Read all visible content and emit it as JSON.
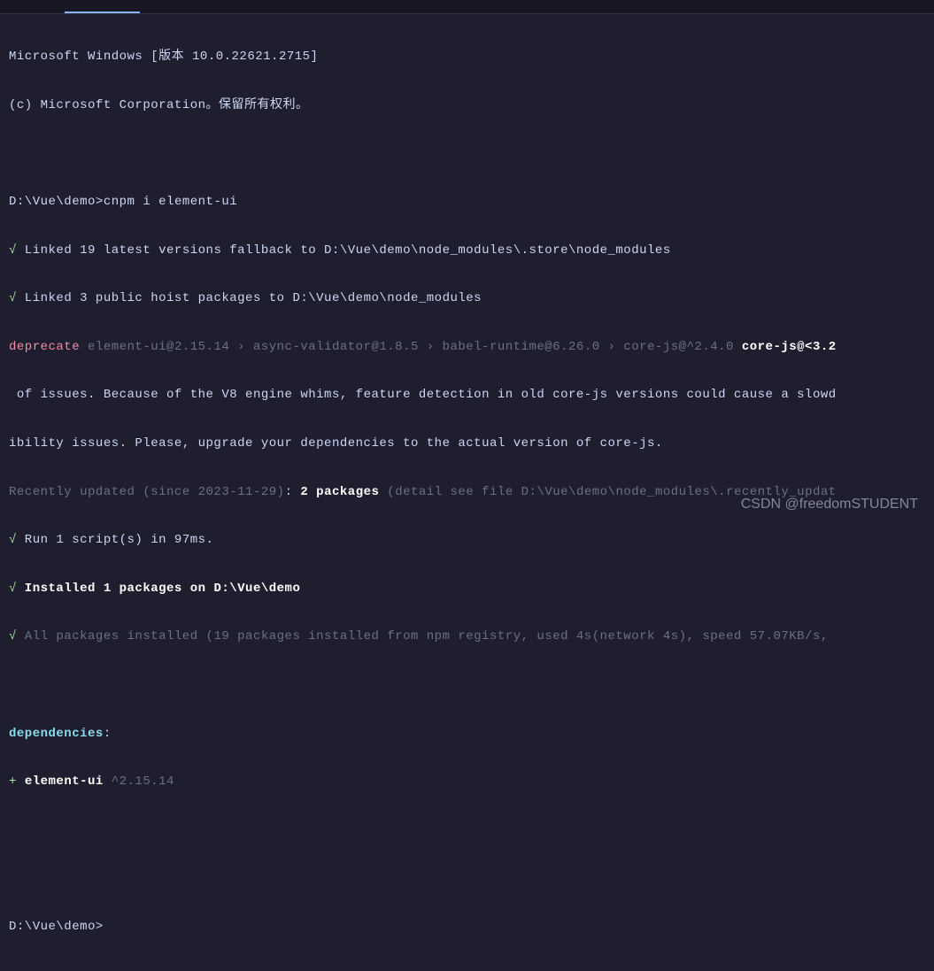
{
  "header": {
    "os_line": "Microsoft Windows [版本 10.0.22621.2715]",
    "copyright": "(c) Microsoft Corporation。保留所有权利。"
  },
  "prompt1": {
    "path": "D:\\Vue\\demo>",
    "command": "cnpm i element-ui"
  },
  "output": {
    "check1_mark": "√",
    "check1_text": " Linked 19 latest versions fallback to D:\\Vue\\demo\\node_modules\\.store\\node_modules",
    "check2_mark": "√",
    "check2_text": " Linked 3 public hoist packages to D:\\Vue\\demo\\node_modules",
    "deprecate_label": "deprecate",
    "deprecate_chain": " element-ui@2.15.14 › async-validator@1.8.5 › babel-runtime@6.26.0 › core-js@^2.4.0 ",
    "deprecate_pkg": "core-js@<3.2",
    "deprecate_msg1": " of issues. Because of the V8 engine whims, feature detection in old core-js versions could cause a slowd",
    "deprecate_msg2": "ibility issues. Please, upgrade your dependencies to the actual version of core-js.",
    "recent_prefix": "Recently updated (since 2023-11-29)",
    "recent_colon": ": ",
    "recent_count": "2",
    "recent_pkg": " packages",
    "recent_detail": " (detail see file D:\\Vue\\demo\\node_modules\\.recently_updat",
    "check3_mark": "√",
    "check3_text": " Run 1 script(s) in 97ms.",
    "check4_mark": "√",
    "check4_text": " Installed 1 packages on D:\\Vue\\demo",
    "check5_mark": "√",
    "check5_text": " All packages installed (19 packages installed from npm registry, used 4s(network 4s), speed 57.07KB/s, "
  },
  "deps": {
    "label": "dependencies",
    "colon": ":",
    "plus": "+ ",
    "pkg_name": "element-ui",
    "pkg_version": " ^2.15.14"
  },
  "prompt2": {
    "path": "D:\\Vue\\demo>"
  },
  "watermark": "CSDN @freedomSTUDENT"
}
